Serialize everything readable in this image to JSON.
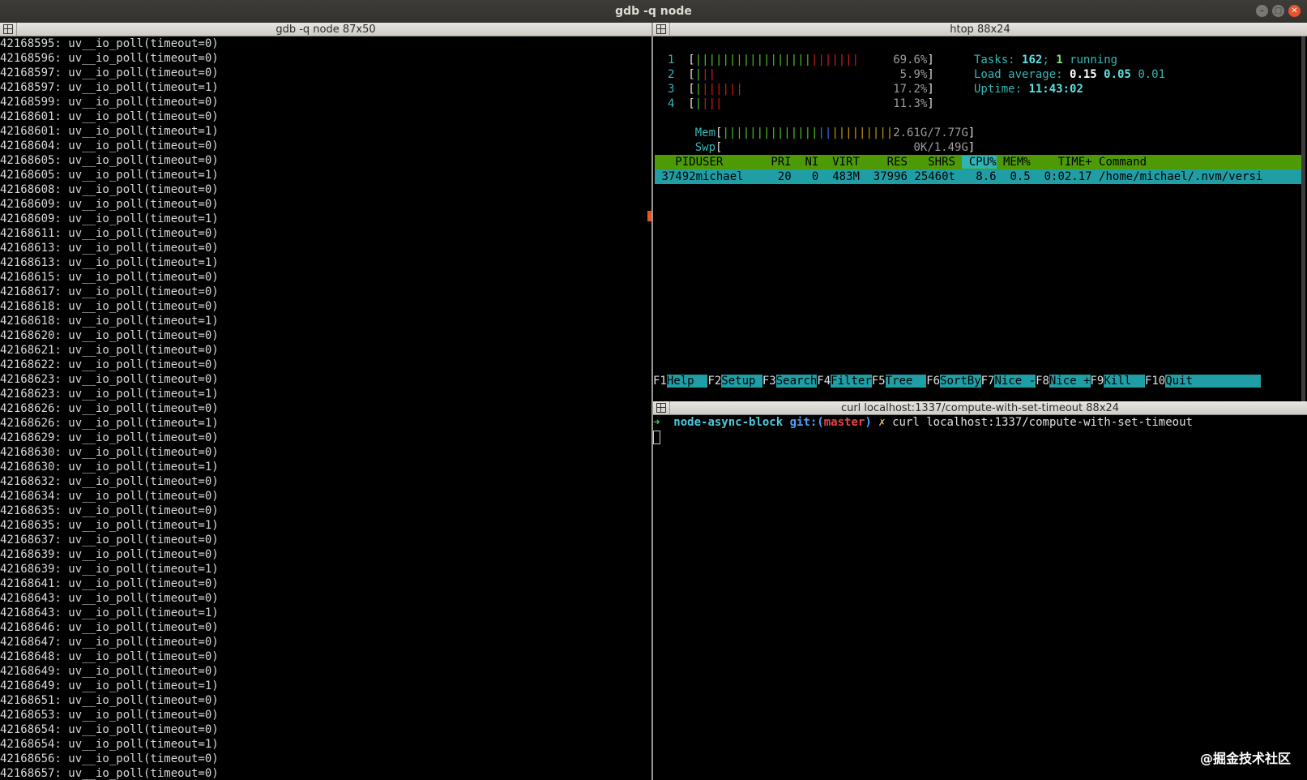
{
  "window": {
    "title": "gdb -q node"
  },
  "left_pane": {
    "tab_title": "gdb -q node 87x50",
    "lines": [
      "42168595: uv__io_poll(timeout=0)",
      "42168596: uv__io_poll(timeout=0)",
      "42168597: uv__io_poll(timeout=0)",
      "42168597: uv__io_poll(timeout=1)",
      "42168599: uv__io_poll(timeout=0)",
      "42168601: uv__io_poll(timeout=0)",
      "42168601: uv__io_poll(timeout=1)",
      "42168604: uv__io_poll(timeout=0)",
      "42168605: uv__io_poll(timeout=0)",
      "42168605: uv__io_poll(timeout=1)",
      "42168608: uv__io_poll(timeout=0)",
      "42168609: uv__io_poll(timeout=0)",
      "42168609: uv__io_poll(timeout=1)",
      "42168611: uv__io_poll(timeout=0)",
      "42168613: uv__io_poll(timeout=0)",
      "42168613: uv__io_poll(timeout=1)",
      "42168615: uv__io_poll(timeout=0)",
      "42168617: uv__io_poll(timeout=0)",
      "42168618: uv__io_poll(timeout=0)",
      "42168618: uv__io_poll(timeout=1)",
      "42168620: uv__io_poll(timeout=0)",
      "42168621: uv__io_poll(timeout=0)",
      "42168622: uv__io_poll(timeout=0)",
      "42168623: uv__io_poll(timeout=0)",
      "42168623: uv__io_poll(timeout=1)",
      "42168626: uv__io_poll(timeout=0)",
      "42168626: uv__io_poll(timeout=1)",
      "42168629: uv__io_poll(timeout=0)",
      "42168630: uv__io_poll(timeout=0)",
      "42168630: uv__io_poll(timeout=1)",
      "42168632: uv__io_poll(timeout=0)",
      "42168634: uv__io_poll(timeout=0)",
      "42168635: uv__io_poll(timeout=0)",
      "42168635: uv__io_poll(timeout=1)",
      "42168637: uv__io_poll(timeout=0)",
      "42168639: uv__io_poll(timeout=0)",
      "42168639: uv__io_poll(timeout=1)",
      "42168641: uv__io_poll(timeout=0)",
      "42168643: uv__io_poll(timeout=0)",
      "42168643: uv__io_poll(timeout=1)",
      "42168646: uv__io_poll(timeout=0)",
      "42168647: uv__io_poll(timeout=0)",
      "42168648: uv__io_poll(timeout=0)",
      "42168649: uv__io_poll(timeout=0)",
      "42168649: uv__io_poll(timeout=1)",
      "42168651: uv__io_poll(timeout=0)",
      "42168653: uv__io_poll(timeout=0)",
      "42168654: uv__io_poll(timeout=0)",
      "42168654: uv__io_poll(timeout=1)",
      "42168656: uv__io_poll(timeout=0)",
      "42168657: uv__io_poll(timeout=0)"
    ]
  },
  "htop": {
    "tab_title": "htop 88x24",
    "cpus": [
      {
        "id": "1",
        "percent": "69.6%",
        "green": 17,
        "red": 7
      },
      {
        "id": "2",
        "percent": "5.9%",
        "green": 1,
        "red": 2
      },
      {
        "id": "3",
        "percent": "17.2%",
        "green": 1,
        "red": 6
      },
      {
        "id": "4",
        "percent": "11.3%",
        "green": 1,
        "red": 3
      }
    ],
    "mem": {
      "label": "Mem",
      "value": "2.61G/7.77G",
      "green": 14,
      "blue": 2,
      "orange": 9
    },
    "swp": {
      "label": "Swp",
      "value": "0K/1.49G"
    },
    "tasks": {
      "label": "Tasks:",
      "count": "162",
      "sep": ";",
      "running": "1",
      "running_label": "running"
    },
    "load": {
      "label": "Load average:",
      "v1": "0.15",
      "v5": "0.05",
      "v15": "0.01"
    },
    "uptime": {
      "label": "Uptime:",
      "value": "11:43:02"
    },
    "columns": [
      "PID",
      "USER",
      "PRI",
      "NI",
      "VIRT",
      "RES",
      "SHR",
      "S",
      "CPU%",
      "MEM%",
      "TIME+",
      "Command"
    ],
    "process": {
      "pid": "37492",
      "user": "michael",
      "pri": "20",
      "ni": "0",
      "virt": "483M",
      "res": "37996",
      "shr": "25460",
      "s": "t",
      "cpu": "8.6",
      "mem": "0.5",
      "time": "0:02.17",
      "command": "/home/michael/.nvm/versi"
    },
    "fkeys": [
      {
        "key": "F1",
        "label": "Help  "
      },
      {
        "key": "F2",
        "label": "Setup "
      },
      {
        "key": "F3",
        "label": "Search"
      },
      {
        "key": "F4",
        "label": "Filter"
      },
      {
        "key": "F5",
        "label": "Tree  "
      },
      {
        "key": "F6",
        "label": "SortBy"
      },
      {
        "key": "F7",
        "label": "Nice -"
      },
      {
        "key": "F8",
        "label": "Nice +"
      },
      {
        "key": "F9",
        "label": "Kill  "
      },
      {
        "key": "F10",
        "label": "Quit          "
      }
    ]
  },
  "curl_pane": {
    "tab_title": "curl localhost:1337/compute-with-set-timeout 88x24",
    "arrow": "➜",
    "dir": "node-async-block",
    "git_label": "git:(",
    "branch": "master",
    "git_close": ")",
    "dirty": "✗",
    "command": "curl localhost:1337/compute-with-set-timeout"
  },
  "watermark": "@掘金技术社区",
  "colors": {
    "htop_header": "#4e9a06",
    "htop_selected": "#1f9ea5",
    "accent_marker": "#e95420"
  }
}
